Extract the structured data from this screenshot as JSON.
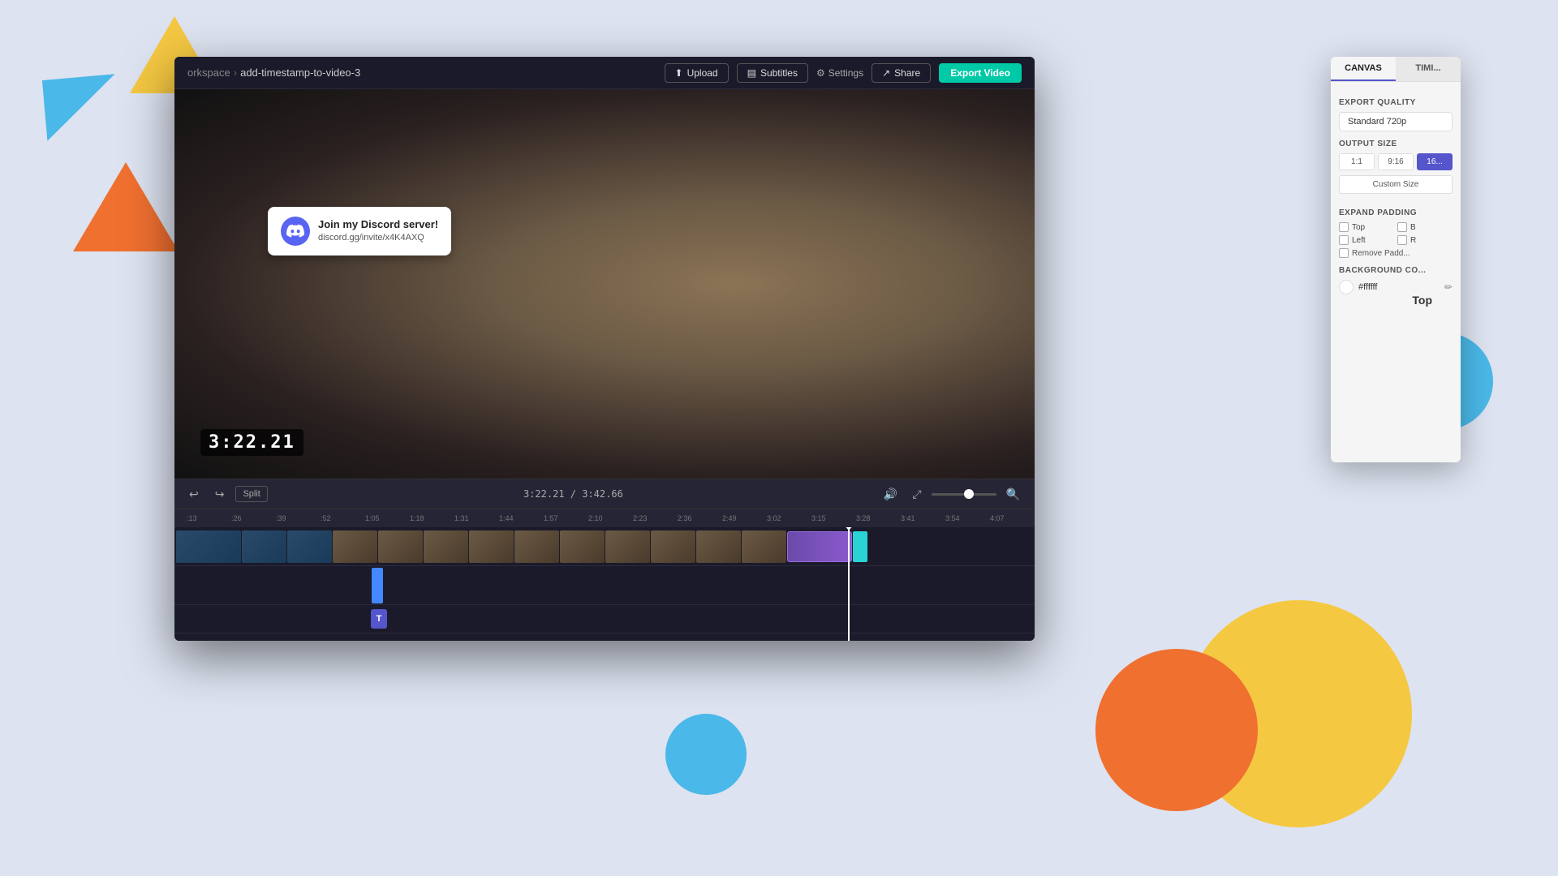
{
  "background": {
    "color": "#dde3f0"
  },
  "breadcrumb": {
    "workspace": "orkspace",
    "separator": "›",
    "page": "add-timestamp-to-video-3"
  },
  "topbar": {
    "upload_label": "Upload",
    "subtitles_label": "Subtitles",
    "settings_label": "Settings",
    "share_label": "Share",
    "export_label": "Export Video"
  },
  "video": {
    "timestamp": "3:22.21",
    "duration_current": "3:22.21",
    "duration_total": "3:42.66"
  },
  "discord_card": {
    "title": "Join my Discord server!",
    "link": "discord.gg/invite/x4K4AXQ"
  },
  "controls": {
    "split_label": "Split",
    "time_display": "3:22.21 / 3:42.66"
  },
  "timeline": {
    "markers": [
      "1:05",
      "1:18",
      "1:31",
      "1:44",
      "1:57",
      "2:10",
      "2:23",
      "2:36",
      "2:49",
      "3:02",
      "3:15",
      "3:28",
      "3:41",
      "3:54",
      "4:07"
    ],
    "sub_markers": [
      ":13",
      ":26",
      ":39",
      ":52"
    ]
  },
  "right_panel": {
    "tabs": [
      {
        "label": "CANVAS",
        "active": true
      },
      {
        "label": "TIMI...",
        "active": false
      }
    ],
    "export_quality_label": "EXPORT QUALITY",
    "quality_value": "Standard 720p",
    "output_size_label": "OUTPUT SIZE",
    "size_options": [
      {
        "label": "1:1",
        "active": false
      },
      {
        "label": "9:16",
        "active": false
      },
      {
        "label": "16...",
        "active": true
      }
    ],
    "custom_size_label": "Custom Size",
    "expand_padding_label": "EXPAND PADDING",
    "padding_options": [
      {
        "label": "Top",
        "checked": false
      },
      {
        "label": "B...",
        "checked": false
      },
      {
        "label": "Left",
        "checked": false
      },
      {
        "label": "R...",
        "checked": false
      }
    ],
    "remove_padding_label": "Remove Padd...",
    "bg_color_label": "BACKGROUND CO...",
    "bg_color_hex": "#ffffff",
    "top_label": "Top"
  }
}
